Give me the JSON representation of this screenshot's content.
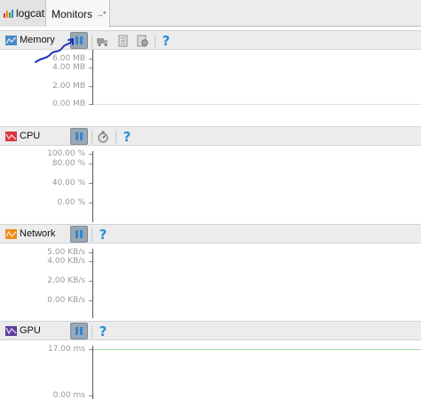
{
  "tabs": [
    {
      "label": "logcat"
    },
    {
      "label": "Monitors",
      "pin": "→*"
    }
  ],
  "colors": {
    "memory": "#4a8ac4",
    "cpu": "#d9363e",
    "network": "#f08a17",
    "gpu": "#5a3d9a",
    "help": "#2a8ed6",
    "pause_bg": "#9aa7b4",
    "annotation": "#1a32b8"
  },
  "monitors": {
    "memory": {
      "title": "Memory",
      "icon": "memory-chart-icon",
      "tools": [
        "pause-icon",
        "truck-icon",
        "document-icon",
        "heap-dump-icon",
        "help-icon"
      ],
      "ticks": [
        "6.00 MB",
        "4.00 MB",
        "2.00 MB",
        "0.00 MB"
      ]
    },
    "cpu": {
      "title": "CPU",
      "icon": "cpu-chart-icon",
      "tools": [
        "pause-icon",
        "stopwatch-icon",
        "help-icon"
      ],
      "ticks": [
        "100.00 %",
        "80.00 %",
        "40.00 %",
        "0.00 %"
      ]
    },
    "network": {
      "title": "Network",
      "icon": "network-chart-icon",
      "tools": [
        "pause-icon",
        "help-icon"
      ],
      "ticks": [
        "5.00 KB/s",
        "4.00 KB/s",
        "2.00 KB/s",
        "0.00 KB/s"
      ]
    },
    "gpu": {
      "title": "GPU",
      "icon": "gpu-chart-icon",
      "tools": [
        "pause-icon",
        "help-icon"
      ],
      "ticks": [
        "17.00 ms",
        "0.00 ms"
      ]
    }
  },
  "help_glyph": "?"
}
